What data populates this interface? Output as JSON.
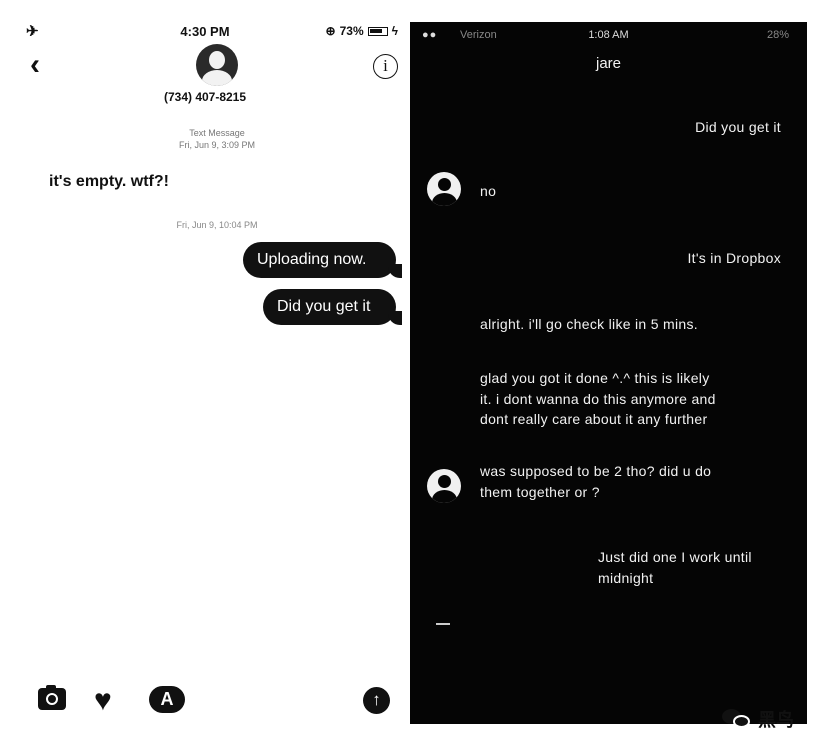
{
  "left_screen": {
    "status_bar": {
      "time": "4:30 PM",
      "battery": "73%"
    },
    "header": {
      "contact_number": "(734) 407-8215",
      "back_icon": "chevron-left-icon",
      "info_icon": "info-icon"
    },
    "thread": {
      "timestamp_1_line1": "Text Message",
      "timestamp_1_line2": "Fri, Jun 9, 3:09 PM",
      "received_message": "it's empty. wtf?!",
      "timestamp_2": "Fri, Jun 9, 10:04 PM",
      "sent_messages": [
        "Uploading now.",
        "Did you get it"
      ]
    },
    "toolbar": {
      "icons": [
        "camera-icon",
        "heart-icon",
        "app-store-icon",
        "send-arrow-icon"
      ],
      "send_glyph": "↑",
      "app_glyph": "A"
    }
  },
  "right_screen": {
    "status_bar": {
      "carrier": "Verizon",
      "time": "1:08 AM",
      "battery": "28%"
    },
    "title": "jare",
    "messages": [
      {
        "side": "out",
        "text": "Did you get it"
      },
      {
        "side": "in",
        "text": "no"
      },
      {
        "side": "out",
        "text": "It's in Dropbox"
      },
      {
        "side": "in",
        "text": "alright. i'll go check like in 5 mins."
      },
      {
        "side": "in",
        "text": "glad you got it done ^.^ this is likely it. i dont wanna do this anymore and dont really care about it any further"
      },
      {
        "side": "in",
        "text": "was supposed to be 2 tho? did u do them together or ?"
      },
      {
        "side": "out",
        "text": "Just did one I work until midnight"
      }
    ]
  },
  "watermark": {
    "text": "黑鸟",
    "icon": "wechat-icon"
  },
  "colors": {
    "dark_bg": "#050505",
    "bubble": "#111111",
    "light_bg": "#ffffff"
  }
}
